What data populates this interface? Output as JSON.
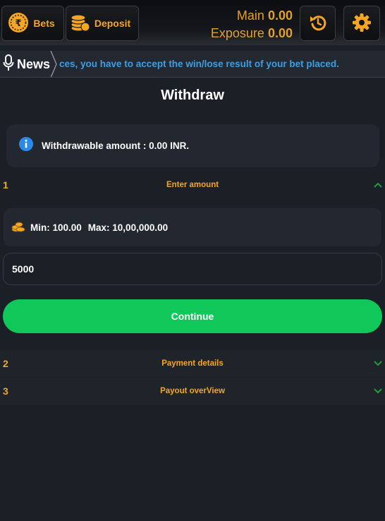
{
  "header": {
    "bets_label": "Bets",
    "deposit_label": "Deposit",
    "main_label": "Main",
    "main_value": "0.00",
    "exposure_label": "Exposure",
    "exposure_value": "0.00"
  },
  "news": {
    "label": "News",
    "ticker": "ces, you have to accept the win/lose result of your bet placed."
  },
  "page": {
    "title": "Withdraw"
  },
  "info": {
    "text": "Withdrawable amount : 0.00 INR."
  },
  "steps": [
    {
      "number": "1",
      "title": "Enter amount",
      "expanded": true
    },
    {
      "number": "2",
      "title": "Payment details",
      "expanded": false
    },
    {
      "number": "3",
      "title": "Payout overView",
      "expanded": false
    }
  ],
  "limits": {
    "min": "Min: 100.00",
    "max": "Max: 10,00,000.00"
  },
  "amount_input": {
    "value": "5000"
  },
  "continue_label": "Continue",
  "colors": {
    "accent": "#f5a623",
    "success": "#10c75a",
    "info": "#2b8ae8",
    "chevron": "#1e9e3e",
    "ticker": "#3f9ee0"
  },
  "icons": [
    "rupee-coin-icon",
    "coins-stack-icon",
    "refresh-icon",
    "gear-icon",
    "microphone-icon",
    "info-icon",
    "coins-icon",
    "chevron-up-icon",
    "chevron-down-icon"
  ]
}
